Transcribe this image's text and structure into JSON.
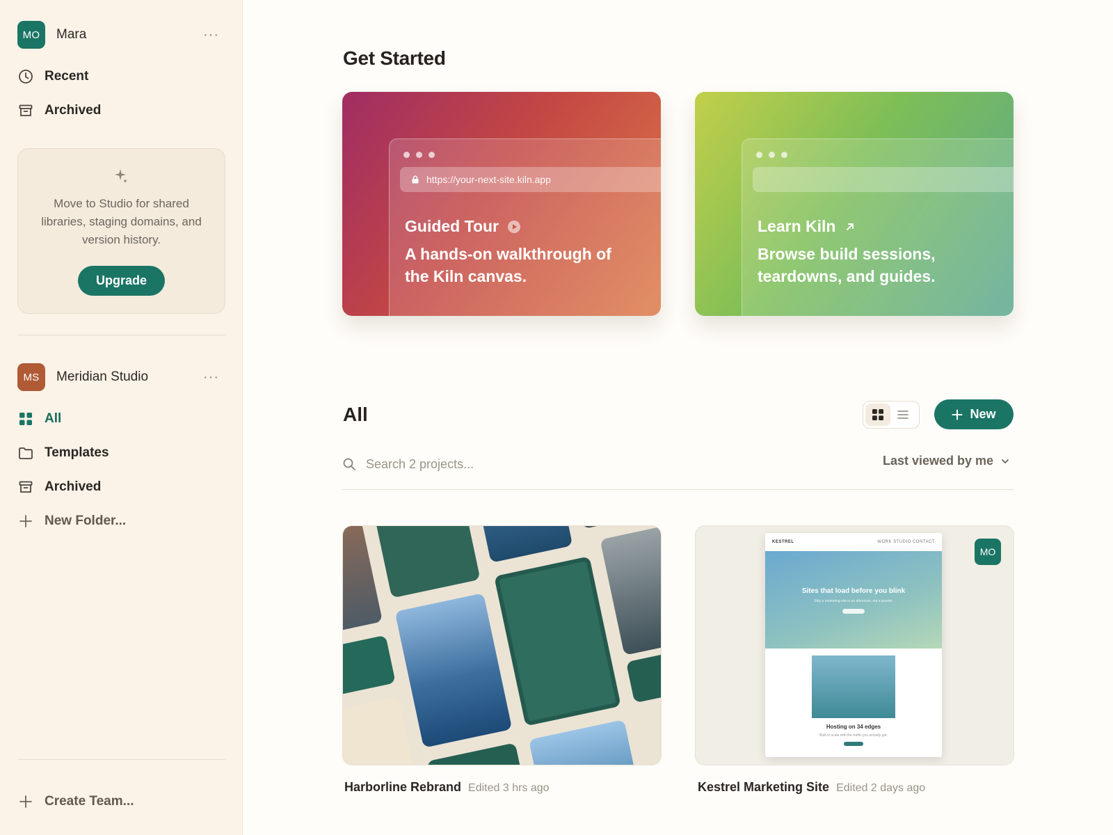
{
  "user": {
    "initials": "MO",
    "name": "Mara",
    "menu_label": "···"
  },
  "user_nav": [
    {
      "label": "Recent",
      "icon": "clock-icon"
    },
    {
      "label": "Archived",
      "icon": "archive-icon"
    }
  ],
  "promo": {
    "text": "Move to Studio for shared libraries, staging domains, and version history.",
    "button_label": "Upgrade"
  },
  "team": {
    "initials": "MS",
    "name": "Meridian Studio",
    "menu_label": "···"
  },
  "team_nav": [
    {
      "label": "All",
      "icon": "grid-icon",
      "active": true
    },
    {
      "label": "Templates",
      "icon": "folder-icon"
    },
    {
      "label": "Archived",
      "icon": "archive-icon"
    },
    {
      "label": "New Folder...",
      "icon": "plus-icon"
    }
  ],
  "create_team_label": "Create Team...",
  "get_started": {
    "title": "Get Started",
    "cards": [
      {
        "title": "Guided Tour",
        "description": "A hands-on walkthrough of the Kiln canvas.",
        "url": "https://your-next-site.kiln.app",
        "icon": "play-circle-icon"
      },
      {
        "title": "Learn Kiln",
        "description": "Browse build sessions, teardowns, and guides.",
        "url": "",
        "icon": "arrow-up-right-icon"
      }
    ]
  },
  "all": {
    "title": "All",
    "new_button_label": "New",
    "search_placeholder": "Search 2 projects...",
    "sort_label": "Last viewed by me",
    "view_mode": "grid"
  },
  "projects": [
    {
      "name": "Harborline Rebrand",
      "edited": "Edited 3 hrs ago"
    },
    {
      "name": "Kestrel Marketing Site",
      "edited": "Edited 2 days ago",
      "badge": "MO",
      "preview": {
        "brand": "KESTREL",
        "nav": "WORK  STUDIO  CONTACT",
        "hero_title": "Sites that load before you blink",
        "hero_sub": "Ship a marketing site in an afternoon, not a quarter.",
        "section_title": "Hosting on 34 edges",
        "section_sub": "Built to scale with the traffic you actually get."
      }
    }
  ],
  "colors": {
    "accent": "#1a7565",
    "sidebar_bg": "#fbf3e8",
    "team_avatar": "#b05a36"
  }
}
